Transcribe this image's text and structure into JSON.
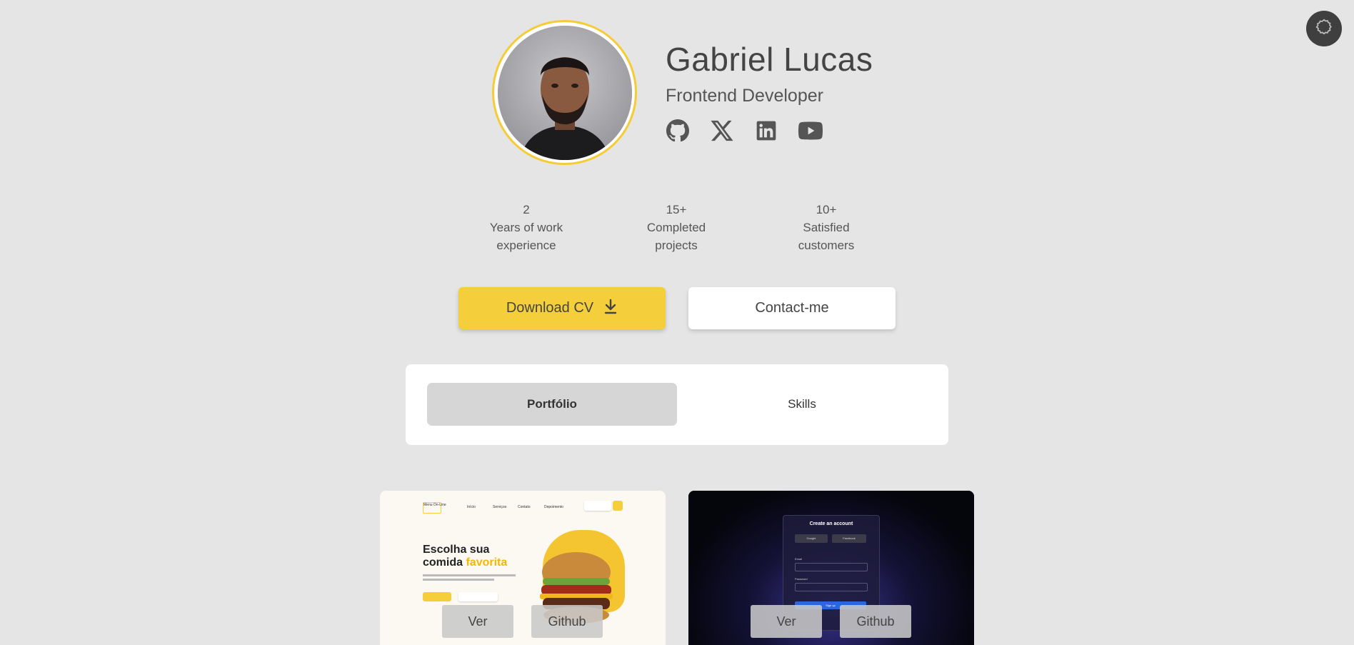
{
  "profile": {
    "name": "Gabriel Lucas",
    "role": "Frontend Developer",
    "socials": [
      "github-icon",
      "x-icon",
      "linkedin-icon",
      "youtube-icon"
    ]
  },
  "stats": [
    {
      "number": "2",
      "label_line1": "Years of work",
      "label_line2": "experience"
    },
    {
      "number": "15+",
      "label_line1": "Completed",
      "label_line2": "projects"
    },
    {
      "number": "10+",
      "label_line1": "Satisfied",
      "label_line2": "customers"
    }
  ],
  "actions": {
    "download_label": "Download CV",
    "contact_label": "Contact-me"
  },
  "tabs": [
    {
      "label": "Portfólio",
      "active": true
    },
    {
      "label": "Skills",
      "active": false
    }
  ],
  "projects": [
    {
      "preview": {
        "logo": "Menu On-Line",
        "nav": [
          "Início",
          "Serviços",
          "Contato",
          "Depoimento"
        ],
        "heading_line1": "Escolha sua",
        "heading_line2_plain": "comida ",
        "heading_line2_accent": "favorita"
      },
      "view_label": "Ver",
      "github_label": "Github"
    },
    {
      "preview": {
        "form_title": "Create an account",
        "google": "Google",
        "facebook": "Facebook",
        "email": "Email",
        "password": "Password",
        "submit": "Sign up"
      },
      "view_label": "Ver",
      "github_label": "Github"
    }
  ],
  "colors": {
    "background": "#e5e5e5",
    "accent": "#f5cf3b",
    "text": "#444444",
    "theme_button": "#3f3f3f"
  }
}
